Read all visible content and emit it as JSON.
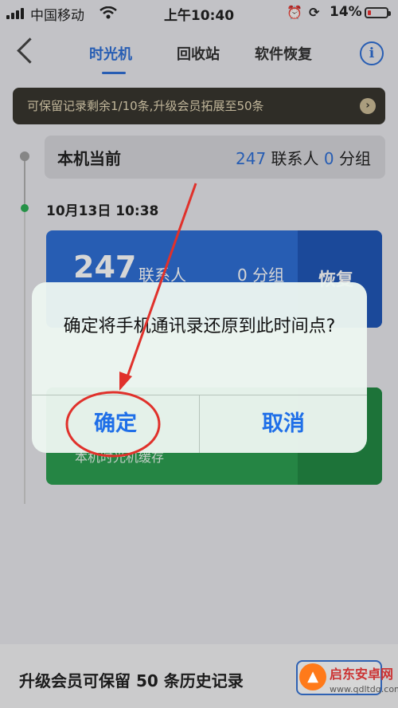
{
  "status_bar": {
    "carrier": "中国移动",
    "time": "上午10:40",
    "battery": "14%"
  },
  "nav": {
    "tabs": [
      {
        "label": "时光机",
        "active": true
      },
      {
        "label": "回收站",
        "active": false
      },
      {
        "label": "软件恢复",
        "active": false
      }
    ],
    "info_label": "i"
  },
  "banner": {
    "text": "可保留记录剩余1/10条,升级会员拓展至50条",
    "arrow": "›"
  },
  "current": {
    "title": "本机当前",
    "contacts_count": "247",
    "contacts_unit": "联系人",
    "groups_count": "0",
    "groups_unit": "分组"
  },
  "snapshot": {
    "time": "10月13日  10:38",
    "contacts_count": "247",
    "contacts_unit": "联系人",
    "groups": "0 分组",
    "restore_label": "恢复"
  },
  "snapshot2": {
    "subtitle": "本机时光机缓存"
  },
  "dialog": {
    "message": "确定将手机通讯录还原到此时间点?",
    "confirm_label": "确定",
    "cancel_label": "取消"
  },
  "bottom_bar": {
    "text": "升级会员可保留 50 条历史记录"
  },
  "watermark": {
    "name": "启东安卓网",
    "url": "www.qdltdq.com"
  },
  "colors": {
    "accent": "#2f6fd6",
    "annotation": "#e0312b",
    "success": "#2dae55"
  }
}
